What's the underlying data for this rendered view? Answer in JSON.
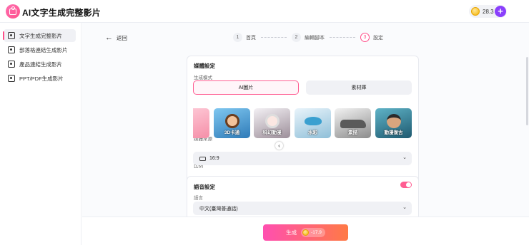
{
  "header": {
    "title": "AI文字生成完整影片",
    "credits": "28.3",
    "add_symbol": "+"
  },
  "sidebar": {
    "items": [
      {
        "label": "文字生成完整影片",
        "active": true
      },
      {
        "label": "部落格連結生成影片",
        "active": false
      },
      {
        "label": "產品連結生成影片",
        "active": false
      },
      {
        "label": "PPT/PDF生成影片",
        "active": false
      }
    ]
  },
  "nav": {
    "back_label": "返回"
  },
  "steps": [
    {
      "num": "1",
      "label": "首頁"
    },
    {
      "num": "2",
      "label": "編輯腳本"
    },
    {
      "num": "3",
      "label": "設定"
    }
  ],
  "media": {
    "title": "媒體設定",
    "mode_label": "生成模式",
    "mode_ai": "AI圖片",
    "mode_library": "素材庫",
    "source_label": "媒體來源",
    "styles": [
      "",
      "3D卡通",
      "科幻動漫",
      "水彩",
      "素描",
      "動漫復古"
    ],
    "ratio_label": "比例",
    "ratio_value": "16:9"
  },
  "voice": {
    "title": "語音設定",
    "language_label": "語言",
    "language_value": "中文(臺灣普通話)",
    "enabled": true
  },
  "footer": {
    "generate_label": "生成",
    "cost": "-17.9"
  },
  "colors": {
    "accent": "#ff4f8a",
    "purple": "#8a3ffc"
  }
}
